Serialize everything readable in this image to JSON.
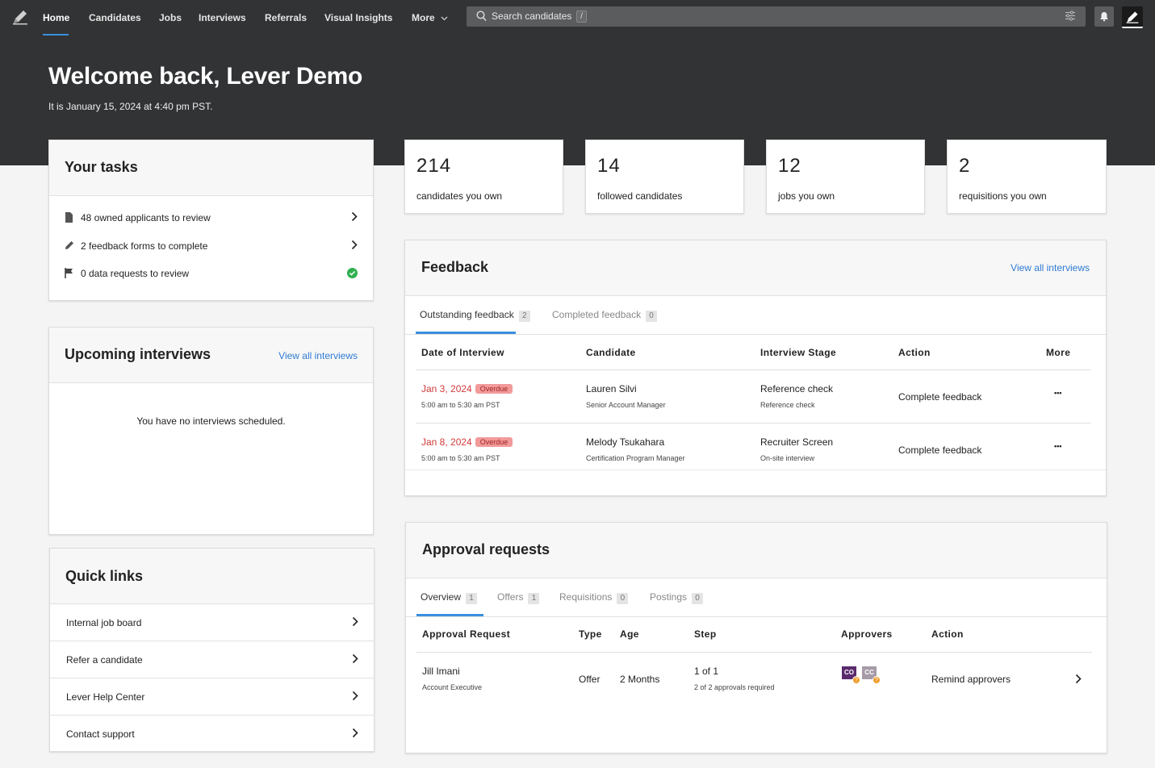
{
  "nav": {
    "items": [
      {
        "label": "Home"
      },
      {
        "label": "Candidates"
      },
      {
        "label": "Jobs"
      },
      {
        "label": "Interviews"
      },
      {
        "label": "Referrals"
      },
      {
        "label": "Visual Insights"
      },
      {
        "label": "More"
      }
    ],
    "search_placeholder": "Search candidates",
    "search_shortcut": "/"
  },
  "hero": {
    "welcome": "Welcome back, Lever Demo",
    "date": "It is January 15, 2024 at 4:40 pm PST."
  },
  "tasks": {
    "title": "Your tasks",
    "items": [
      {
        "label": "48 owned applicants to review",
        "icon": "document-icon"
      },
      {
        "label": "2 feedback forms to complete",
        "icon": "pencil-icon"
      },
      {
        "label": "0 data requests to review",
        "icon": "flag-icon"
      }
    ]
  },
  "stats": [
    {
      "value": "214",
      "label": "candidates you own"
    },
    {
      "value": "14",
      "label": "followed candidates"
    },
    {
      "value": "12",
      "label": "jobs you own"
    },
    {
      "value": "2",
      "label": "requisitions you own"
    }
  ],
  "upcoming": {
    "title": "Upcoming interviews",
    "link": "View all interviews",
    "empty": "You have no interviews scheduled."
  },
  "quicklinks": {
    "title": "Quick links",
    "items": [
      {
        "label": "Internal job board"
      },
      {
        "label": "Refer a candidate"
      },
      {
        "label": "Lever Help Center"
      },
      {
        "label": "Contact support"
      }
    ]
  },
  "feedback": {
    "title": "Feedback",
    "link": "View all interviews",
    "tabs": [
      {
        "label": "Outstanding feedback",
        "count": "2"
      },
      {
        "label": "Completed feedback",
        "count": "0"
      }
    ],
    "columns": [
      "Date of Interview",
      "Candidate",
      "Interview Stage",
      "Action",
      "More"
    ],
    "rows": [
      {
        "date": "Jan 3, 2024",
        "status": "Overdue",
        "time": "5:00 am to 5:30 am PST",
        "candidate": "Lauren Silvi",
        "role": "Senior Account Manager",
        "stage": "Reference check",
        "stage_sub": "Reference check",
        "action": "Complete feedback",
        "more": "•••"
      },
      {
        "date": "Jan 8, 2024",
        "status": "Overdue",
        "time": "5:00 am to 5:30 am PST",
        "candidate": "Melody Tsukahara",
        "role": "Certification Program Manager",
        "stage": "Recruiter Screen",
        "stage_sub": "On-site interview",
        "action": "Complete feedback",
        "more": "•••"
      }
    ]
  },
  "approvals": {
    "title": "Approval requests",
    "tabs": [
      {
        "label": "Overview",
        "count": "1"
      },
      {
        "label": "Offers",
        "count": "1"
      },
      {
        "label": "Requisitions",
        "count": "0"
      },
      {
        "label": "Postings",
        "count": "0"
      }
    ],
    "columns": [
      "Approval Request",
      "Type",
      "Age",
      "Step",
      "Approvers",
      "Action"
    ],
    "rows": [
      {
        "name": "Jill Imani",
        "role": "Account Executive",
        "type": "Offer",
        "age": "2 Months",
        "step": "1 of 1",
        "step_sub": "2 of 2 approvals required",
        "approvers": [
          {
            "initials": "CO",
            "color": "#5a2a6e"
          },
          {
            "initials": "CC",
            "color": "#a79ba8"
          }
        ],
        "pending": "?",
        "action": "Remind approvers"
      }
    ]
  },
  "colors": {
    "accent": "#3b8fe0",
    "link": "#2f7bd4",
    "header": "#323334",
    "success": "#2fb050",
    "overdue_bg": "#f29a9a"
  }
}
